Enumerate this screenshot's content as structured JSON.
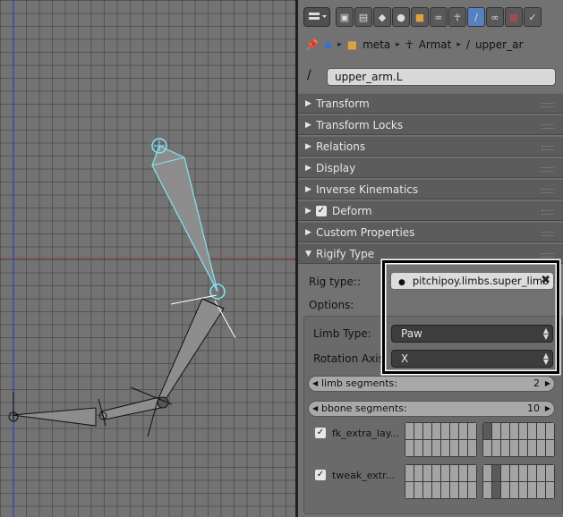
{
  "breadcrumb": {
    "items": [
      {
        "label": "meta"
      },
      {
        "label": "Armat"
      },
      {
        "label": "upper_ar"
      }
    ]
  },
  "bone_name": "upper_arm.L",
  "sections": [
    {
      "label": "Transform",
      "expanded": false,
      "checkbox": false
    },
    {
      "label": "Transform Locks",
      "expanded": false,
      "checkbox": false
    },
    {
      "label": "Relations",
      "expanded": false,
      "checkbox": false
    },
    {
      "label": "Display",
      "expanded": false,
      "checkbox": false
    },
    {
      "label": "Inverse Kinematics",
      "expanded": false,
      "checkbox": false
    },
    {
      "label": "Deform",
      "expanded": false,
      "checkbox": true
    },
    {
      "label": "Custom Properties",
      "expanded": false,
      "checkbox": false
    },
    {
      "label": "Rigify Type",
      "expanded": true,
      "checkbox": false
    }
  ],
  "rigify": {
    "rig_type_label": "Rig type::",
    "rig_type_value": "pitchipoy.limbs.super_limb",
    "options_label": "Options:",
    "limb_type_label": "Limb Type:",
    "limb_type_value": "Paw",
    "rotation_axis_label": "Rotation Axis:",
    "rotation_axis_value": "X",
    "limb_segments_label": "limb segments:",
    "limb_segments_value": "2",
    "bbone_segments_label": "bbone segments:",
    "bbone_segments_value": "10",
    "fk_extra_label": "fk_extra_lay...",
    "fk_extra_checked": true,
    "tweak_extra_label": "tweak_extr...",
    "tweak_extra_checked": true
  },
  "colors": {
    "selected_bone_outline": "#7fe6f2",
    "active_tab": "#5680c2",
    "highlight_frame": "#000000"
  },
  "icons": {
    "bone": "bone-icon",
    "pin": "pin-icon",
    "object": "object-cube-icon",
    "armature": "armature-icon",
    "close": "close-x-icon"
  }
}
